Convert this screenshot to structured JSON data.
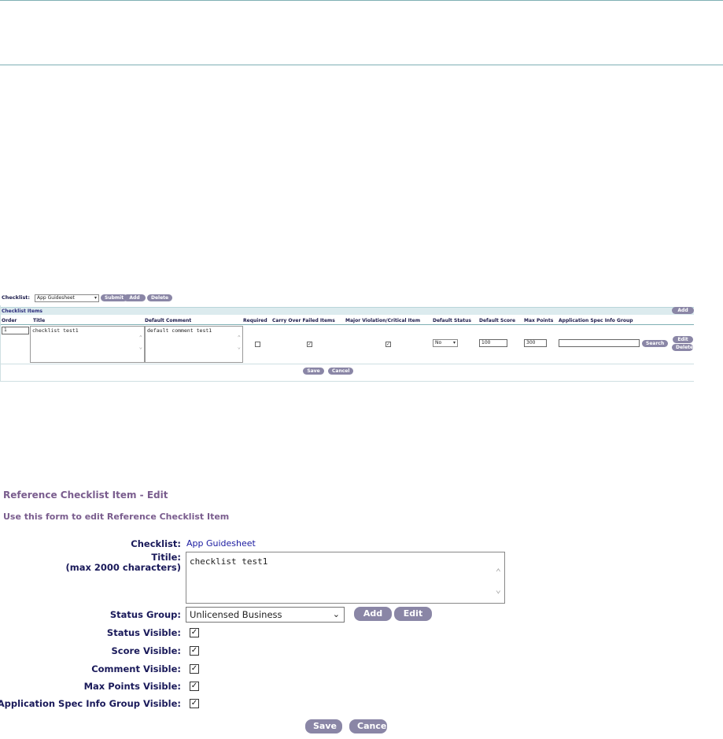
{
  "mini": {
    "checklist_label": "Checklist:",
    "checklist_value": "App Guidesheet",
    "submit": "Submit",
    "add": "Add",
    "delete": "Delete",
    "section_title": "Checklist Items",
    "section_add": "Add",
    "headers": [
      "Order",
      "Title",
      "Default Comment",
      "Required",
      "Carry Over Failed Items",
      "Major Violation/Critical Item",
      "Default Status",
      "Default Score",
      "Max Points",
      "Application Spec Info Group"
    ],
    "row": {
      "order": "1",
      "title": "checklist test1",
      "comment": "default comment test1",
      "required": "",
      "carry_over": "✓",
      "major": "✓",
      "status": "No",
      "score": "100",
      "max_points": "300",
      "asi_group": "",
      "search": "Search",
      "edit": "Edit",
      "delete": "Delete"
    },
    "save": "Save",
    "cancel": "Cancel"
  },
  "form": {
    "heading": "Reference Checklist Item - Edit",
    "subheading": "Use this form to edit Reference Checklist Item",
    "checklist_label": "Checklist:",
    "checklist_value": "App Guidesheet",
    "titile_label": "Titile:",
    "titile_hint": "(max 2000 characters)",
    "titile_value": "checklist test1",
    "status_group_label": "Status Group:",
    "status_group_value": "Unlicensed Business",
    "add": "Add",
    "edit": "Edit",
    "status_visible_label": "Status Visible:",
    "score_visible_label": "Score Visible:",
    "comment_visible_label": "Comment Visible:",
    "max_points_visible_label": "Max Points Visible:",
    "asi_visible_label": "Application Spec Info Group Visible:",
    "check": "✓",
    "save": "Save",
    "cancel": "Cancel"
  }
}
